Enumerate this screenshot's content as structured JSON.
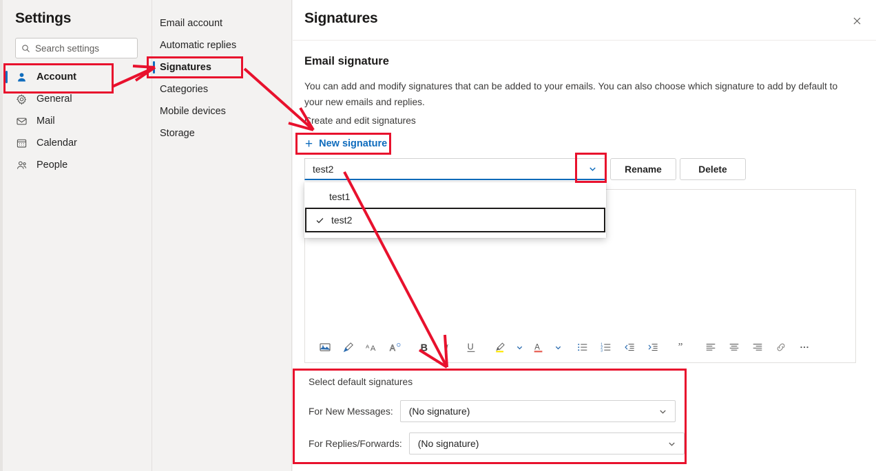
{
  "colors": {
    "accent": "#0f6cbd",
    "annotation_red": "#e8112d",
    "panel_bg": "#f3f2f1",
    "text": "#242424"
  },
  "sidebar": {
    "title": "Settings",
    "search": {
      "placeholder": "Search settings",
      "icon": "search-icon"
    },
    "items": [
      {
        "label": "Account",
        "icon": "person-icon",
        "selected": true
      },
      {
        "label": "General",
        "icon": "gear-icon",
        "selected": false
      },
      {
        "label": "Mail",
        "icon": "envelope-icon",
        "selected": false
      },
      {
        "label": "Calendar",
        "icon": "calendar-icon",
        "selected": false
      },
      {
        "label": "People",
        "icon": "people-icon",
        "selected": false
      }
    ]
  },
  "subnav": {
    "items": [
      {
        "label": "Email account",
        "selected": false
      },
      {
        "label": "Automatic replies",
        "selected": false
      },
      {
        "label": "Signatures",
        "selected": true
      },
      {
        "label": "Categories",
        "selected": false
      },
      {
        "label": "Mobile devices",
        "selected": false
      },
      {
        "label": "Storage",
        "selected": false
      }
    ]
  },
  "main": {
    "title": "Signatures",
    "close_icon": "close-icon",
    "section_heading": "Email signature",
    "description": "You can add and modify signatures that can be added to your emails. You can also choose which signature to add by default to your new emails and replies.",
    "sub_label": "Create and edit signatures",
    "new_signature_label": "New signature",
    "new_signature_icon": "plus-icon",
    "signature_combo": {
      "value": "test2",
      "chevron_icon": "chevron-down-icon",
      "options": [
        {
          "label": "test1",
          "checked": false,
          "highlighted": false
        },
        {
          "label": "test2",
          "checked": true,
          "highlighted": true
        }
      ]
    },
    "rename_label": "Rename",
    "delete_label": "Delete",
    "toolbar": [
      {
        "name": "insert-picture-icon",
        "glyph": "ὛC"
      },
      {
        "name": "format-painter-icon",
        "glyph": ""
      },
      {
        "name": "font-size-icon",
        "glyph": ""
      },
      {
        "name": "font-style-icon",
        "glyph": ""
      },
      {
        "name": "bold-icon",
        "glyph": "B"
      },
      {
        "name": "italic-icon",
        "glyph": "I"
      },
      {
        "name": "underline-icon",
        "glyph": "U"
      },
      {
        "name": "highlight-color-icon",
        "glyph": ""
      },
      {
        "name": "highlight-chevron-down-icon",
        "glyph": ""
      },
      {
        "name": "font-color-icon",
        "glyph": "A"
      },
      {
        "name": "font-color-chevron-down-icon",
        "glyph": ""
      },
      {
        "name": "bulleted-list-icon",
        "glyph": ""
      },
      {
        "name": "numbered-list-icon",
        "glyph": ""
      },
      {
        "name": "decrease-indent-icon",
        "glyph": ""
      },
      {
        "name": "increase-indent-icon",
        "glyph": ""
      },
      {
        "name": "quote-icon",
        "glyph": "”"
      },
      {
        "name": "align-left-icon",
        "glyph": ""
      },
      {
        "name": "align-center-icon",
        "glyph": ""
      },
      {
        "name": "align-right-icon",
        "glyph": ""
      },
      {
        "name": "insert-link-icon",
        "glyph": ""
      },
      {
        "name": "more-options-icon",
        "glyph": "…"
      }
    ],
    "defaults": {
      "title": "Select default signatures",
      "new_messages_label": "For New Messages:",
      "new_messages_value": "(No signature)",
      "replies_label": "For Replies/Forwards:",
      "replies_value": "(No signature)",
      "chevron_icon": "chevron-down-icon"
    }
  }
}
